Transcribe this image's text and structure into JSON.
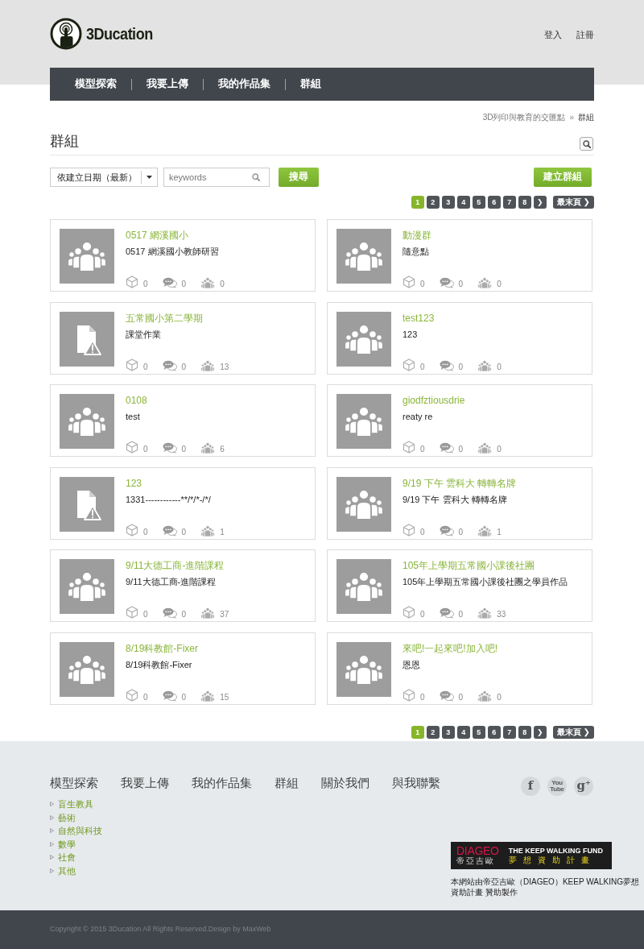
{
  "header": {
    "logo_text": "3Ducation",
    "auth_links": [
      "登入",
      "註冊"
    ]
  },
  "nav": [
    "模型探索",
    "我要上傳",
    "我的作品集",
    "群組"
  ],
  "breadcrumb": {
    "items": [
      "3D列印與教育的交匯點",
      "群組"
    ],
    "separator": "»"
  },
  "page_title": "群組",
  "toolbar": {
    "sort": "依建立日期（最新）",
    "search_placeholder": "keywords",
    "search_button": "搜尋",
    "create_button": "建立群組"
  },
  "pagination_top": [
    {
      "kind": "page",
      "label": "1",
      "selected": true
    },
    {
      "kind": "page",
      "label": "2",
      "selected": false
    },
    {
      "kind": "page",
      "label": "3",
      "selected": false
    },
    {
      "kind": "page",
      "label": "4",
      "selected": false
    },
    {
      "kind": "page",
      "label": "5",
      "selected": false
    },
    {
      "kind": "page",
      "label": "6",
      "selected": false
    },
    {
      "kind": "page",
      "label": "7",
      "selected": false
    },
    {
      "kind": "page",
      "label": "8",
      "selected": false
    },
    {
      "kind": "next",
      "label": "❯",
      "selected": false
    },
    {
      "kind": "last",
      "label": "最末頁 ❯",
      "selected": false
    }
  ],
  "groups": [
    {
      "kind": "group",
      "title": "0517 網溪國小",
      "description": "0517 網溪國小教師研習",
      "models": "0",
      "comments": "0",
      "members": "0"
    },
    {
      "kind": "group",
      "title": "動漫群",
      "description": "隨意點",
      "models": "0",
      "comments": "0",
      "members": "0"
    },
    {
      "kind": "broken-file",
      "title": "五常國小第二學期",
      "description": "課堂作業",
      "models": "0",
      "comments": "0",
      "members": "13"
    },
    {
      "kind": "group",
      "title": "test123",
      "description": "123",
      "models": "0",
      "comments": "0",
      "members": "0"
    },
    {
      "kind": "group",
      "title": "0108",
      "description": "test",
      "models": "0",
      "comments": "0",
      "members": "6"
    },
    {
      "kind": "group",
      "title": "giodfztiousdrie",
      "description": "reaty re",
      "models": "0",
      "comments": "0",
      "members": "0"
    },
    {
      "kind": "broken-file",
      "title": "123",
      "description": "1331------------**/*/*-/*/",
      "models": "0",
      "comments": "0",
      "members": "1"
    },
    {
      "kind": "group",
      "title": "9/19 下午 雲科大 轉轉名牌",
      "description": "9/19 下午 雲科大 轉轉名牌",
      "models": "0",
      "comments": "0",
      "members": "1"
    },
    {
      "kind": "group",
      "title": "9/11大德工商-進階課程",
      "description": "9/11大德工商-進階課程",
      "models": "0",
      "comments": "0",
      "members": "37"
    },
    {
      "kind": "group",
      "title": "105年上學期五常國小課後社團",
      "description": "105年上學期五常國小課後社團之學員作品",
      "models": "0",
      "comments": "0",
      "members": "33"
    },
    {
      "kind": "group",
      "title": "8/19科教館-Fixer",
      "description": "8/19科教館-Fixer",
      "models": "0",
      "comments": "0",
      "members": "15"
    },
    {
      "kind": "group",
      "title": "來吧!一起來吧!加入吧!",
      "description": "恩恩",
      "models": "0",
      "comments": "0",
      "members": "0"
    }
  ],
  "pagination_bottom": [
    {
      "kind": "page",
      "label": "1",
      "selected": true
    },
    {
      "kind": "page",
      "label": "2",
      "selected": false
    },
    {
      "kind": "page",
      "label": "3",
      "selected": false
    },
    {
      "kind": "page",
      "label": "4",
      "selected": false
    },
    {
      "kind": "page",
      "label": "5",
      "selected": false
    },
    {
      "kind": "page",
      "label": "6",
      "selected": false
    },
    {
      "kind": "page",
      "label": "7",
      "selected": false
    },
    {
      "kind": "page",
      "label": "8",
      "selected": false
    },
    {
      "kind": "next",
      "label": "❯",
      "selected": false
    },
    {
      "kind": "last",
      "label": "最末頁 ❯",
      "selected": false
    }
  ],
  "footer": {
    "nav": [
      "模型探索",
      "我要上傳",
      "我的作品集",
      "群組",
      "關於我們",
      "與我聯繫"
    ],
    "categories": [
      "盲生教具",
      "藝術",
      "自然與科技",
      "數學",
      "社會",
      "其他"
    ],
    "social": [
      {
        "kind": "facebook",
        "glyph": "f"
      },
      {
        "kind": "youtube",
        "glyph": "You Tube"
      },
      {
        "kind": "google-plus",
        "glyph": "g$^{+}$"
      }
    ],
    "sponsor": {
      "brand": "DIAGEO",
      "brand_subtitle": "帝亞吉歐",
      "fund": "THE KEEP WALKING FUND",
      "fund_subtitle": "夢想資助計畫",
      "caption": "本網站由帝亞吉歐（DIAGEO）KEEP WALKING夢想資助計畫 贊助製作"
    },
    "copyright": "Copyright © 2015 3Ducation All Rights Reserved.Design by MaxWeb"
  }
}
